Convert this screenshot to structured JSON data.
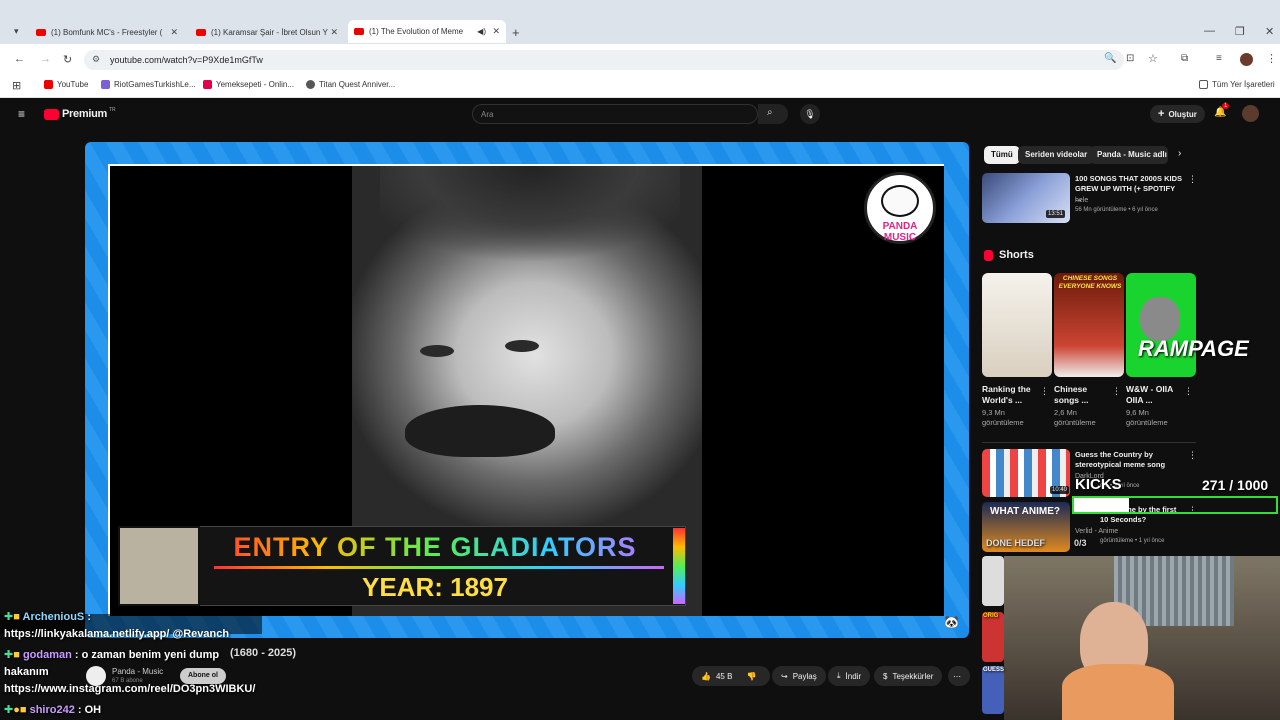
{
  "browser": {
    "tabs": [
      {
        "title": "(1) Bomfunk MC's - Freestyler (",
        "close": "✕"
      },
      {
        "title": "(1) Karamsar Şair - İbret Olsun Y",
        "close": "✕"
      },
      {
        "title": "(1) The Evolution of Meme",
        "close": "✕"
      }
    ],
    "new_tab": "+",
    "url": "youtube.com/watch?v=P9Xde1mGfTw",
    "bookmarks": [
      "YouTube",
      "RiotGamesTurkishLe...",
      "Yemeksepeti - Onlin...",
      "Titan Quest Anniver..."
    ],
    "all_bookmarks": "Tüm Yer İşaretleri",
    "colors": {
      "yt_red": "#ff0033"
    }
  },
  "youtube": {
    "logo_text": "Premium",
    "region": "TR",
    "search_placeholder": "Ara",
    "create_label": "Oluştur",
    "notif_count": "1"
  },
  "video": {
    "overlay_title": "ENTRY OF THE GLADIATORS",
    "overlay_year": "YEAR: 1897",
    "panda_logo_text": "PANDA MUSIC",
    "title_partial": "(1680 - 2025)",
    "channel": "Panda - Music",
    "subscribers": "67 B abone",
    "subscribe": "Abone ol",
    "likes": "45 B",
    "share": "Paylaş",
    "download": "İndir",
    "thanks": "Teşekkürler",
    "more": "⋯"
  },
  "sidebar": {
    "chips": [
      "Tümü",
      "Seriden videolar",
      "Panda - Music adlı yü"
    ],
    "top_video": {
      "title": "100 SONGS THAT 2000S KIDS GREW UP WITH (+ SPOTIFY ...",
      "channel": "hele",
      "meta": "56 Mn görüntüleme • 6 yıl önce",
      "duration": "13:51"
    },
    "shorts_header": "Shorts",
    "shorts": [
      {
        "title": "Ranking the World's ...",
        "views": "9,3 Mn görüntüleme"
      },
      {
        "title": "Chinese songs ...",
        "views": "2,6 Mn görüntüleme",
        "thumb_text": "CHINESE SONGS EVERYONE KNOWS"
      },
      {
        "title": "W&W - OIIA OIIA ...",
        "views": "9,6 Mn görüntüleme"
      }
    ],
    "video2": {
      "title": "Guess the Country by stereotypical meme song",
      "channel": "DarkLord",
      "meta": "me • 3 yıl önce",
      "duration": "10:40"
    },
    "video3": {
      "title": "the Anime by the first 10 Seconds?",
      "channel": "Verlid - Anime",
      "meta": "görüntüleme • 1 yıl önce",
      "thumb_text": "WHAT ANIME?"
    }
  },
  "stream_overlay": {
    "rampage": "RAMPAGE",
    "kicks": "KICKS",
    "counter": "271  / 1000",
    "done": "DONE HEDEF",
    "done_count": "0/3",
    "side_label_1": "ORIG",
    "side_label_2": "GUESS"
  },
  "chat": [
    {
      "user": "ArcheniouS",
      "text": ":",
      "user_color": "#8fd8ff"
    },
    {
      "user": "",
      "text": "https://linkyakalama.netlify.app/ @Revanch",
      "user_color": "#ffffff"
    },
    {
      "user": "godaman",
      "text": ": o zaman benim yeni dump",
      "user_color": "#c89cff"
    },
    {
      "user": "",
      "text": "hakanım",
      "user_color": "#ffffff"
    },
    {
      "user": "",
      "text": "https://www.instagram.com/reel/DO3pn3WIBKU/",
      "user_color": "#ffffff"
    },
    {
      "user": "shiro242",
      "text": ": OH",
      "user_color": "#c89cff"
    }
  ]
}
